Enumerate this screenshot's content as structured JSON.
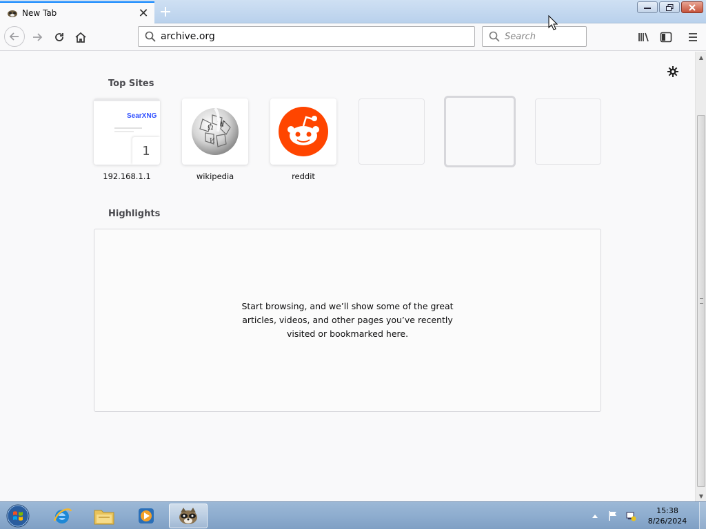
{
  "browser": {
    "tab": {
      "title": "New Tab",
      "close_glyph": "✕"
    },
    "new_tab_glyph": "+",
    "url": "archive.org",
    "search_placeholder": "Search"
  },
  "newtab": {
    "top_sites_title": "Top Sites",
    "highlights_title": "Highlights",
    "sites": [
      {
        "label": "192.168.1.1",
        "thumb_text": "SearXNG",
        "badge": "1"
      },
      {
        "label": "wikipedia"
      },
      {
        "label": "reddit"
      }
    ],
    "highlights_message": "Start browsing, and we’ll show some of the great articles, videos, and other pages you’ve recently visited or bookmarked here."
  },
  "taskbar": {
    "time": "15:38",
    "date": "8/26/2024",
    "apps": [
      "internet-explorer",
      "windows-explorer",
      "media-player",
      "firefox"
    ]
  },
  "colors": {
    "accent": "#0a84ff",
    "reddit": "#ff4500",
    "searx": "#3050ff"
  }
}
